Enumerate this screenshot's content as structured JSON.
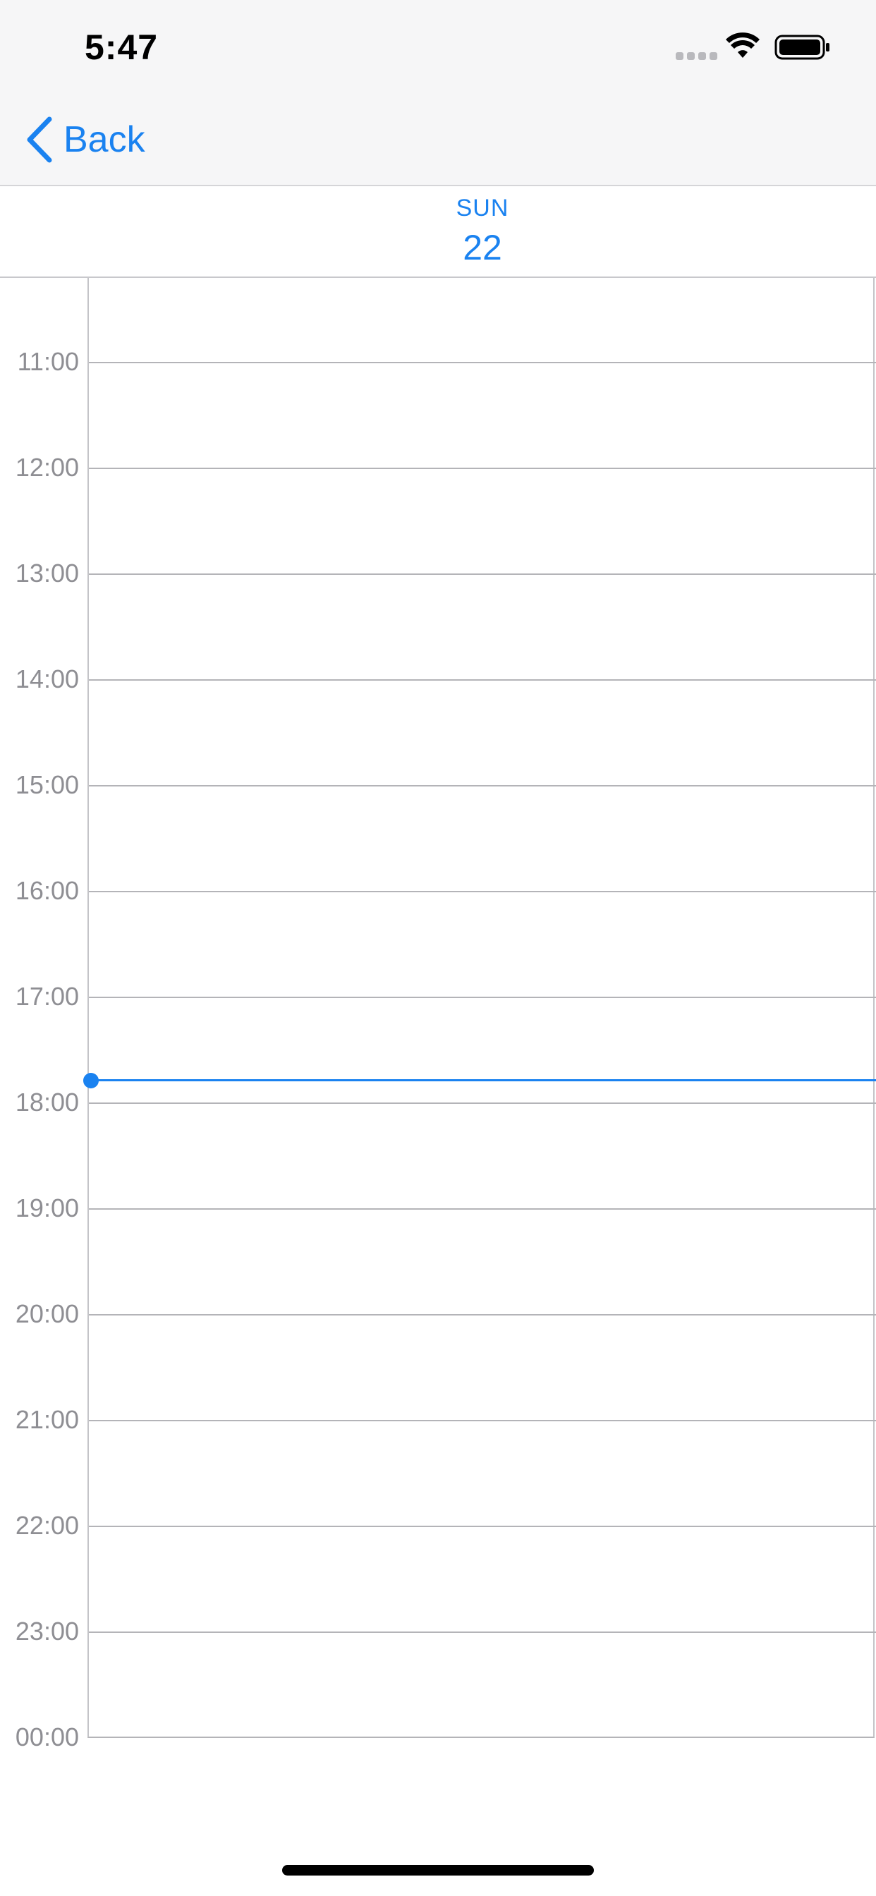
{
  "status_bar": {
    "time": "5:47"
  },
  "nav": {
    "back_label": "Back",
    "accent_color": "#1a82f0"
  },
  "day": {
    "weekday": "SUN",
    "date": "22"
  },
  "timeline": {
    "hours": [
      "11:00",
      "12:00",
      "13:00",
      "14:00",
      "15:00",
      "16:00",
      "17:00",
      "18:00",
      "19:00",
      "20:00",
      "21:00",
      "22:00",
      "23:00",
      "00:00"
    ],
    "now_time_fraction": 17.78
  },
  "icons": {
    "signal": "cellular-signal-icon",
    "wifi": "wifi-icon",
    "battery": "battery-icon",
    "back": "chevron-left-icon"
  }
}
